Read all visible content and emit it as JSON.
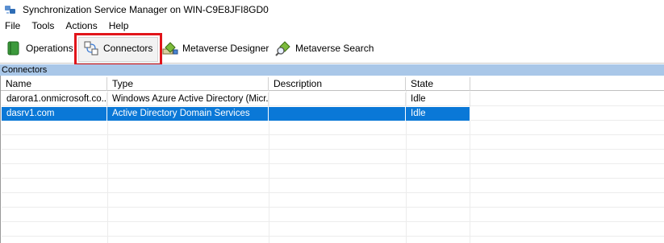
{
  "window": {
    "title": "Synchronization Service Manager on WIN-C9E8JFI8GD0"
  },
  "menu": [
    "File",
    "Tools",
    "Actions",
    "Help"
  ],
  "toolbar": {
    "operations": "Operations",
    "connectors": "Connectors",
    "metaverse_designer": "Metaverse Designer",
    "metaverse_search": "Metaverse Search",
    "selected": "Connectors"
  },
  "section": {
    "title": "Connectors"
  },
  "table": {
    "columns": [
      "Name",
      "Type",
      "Description",
      "State"
    ],
    "rows": [
      {
        "name": "darora1.onmicrosoft.co...",
        "type": "Windows Azure Active Directory (Micr...",
        "description": "",
        "state": "Idle",
        "selected": false
      },
      {
        "name": "dasrv1.com",
        "type": "Active Directory Domain Services",
        "description": "",
        "state": "Idle",
        "selected": true
      }
    ]
  },
  "colors": {
    "selection": "#0a78d7",
    "section_header": "#a9c7e8",
    "highlight_frame": "#e1141a"
  }
}
